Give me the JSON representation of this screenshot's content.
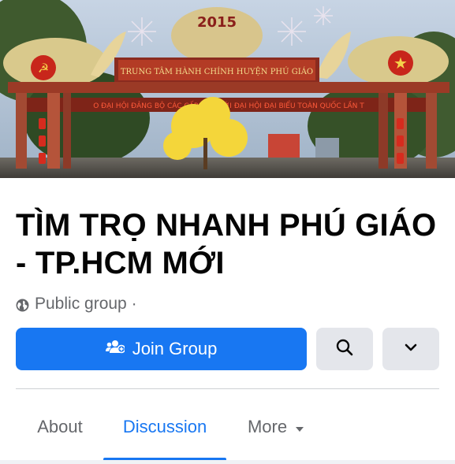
{
  "cover": {
    "year_text": "2015",
    "gate_sign": "TRUNG TÂM HÀNH CHÍNH HUYỆN PHÚ GIÁO",
    "banner_text": "O ĐẠI HỘI ĐẢNG BỘ CÁC CẤP TIẾN TỚI ĐẠI HỘI ĐẠI BIỂU TOÀN QUỐC LẦN T"
  },
  "group": {
    "name": "TÌM TRỌ NHANH PHÚ GIÁO - TP.HCM MỚI",
    "privacy": "Public group ·"
  },
  "actions": {
    "join_label": "Join Group",
    "join_icon": "join-group-icon",
    "search_icon": "search-icon",
    "more_icon": "chevron-down-icon"
  },
  "tabs": [
    {
      "label": "About",
      "active": false
    },
    {
      "label": "Discussion",
      "active": true
    },
    {
      "label": "More",
      "active": false
    }
  ],
  "colors": {
    "primary": "#1877f2",
    "secondary_button": "#e4e6eb",
    "text_dark": "#050505",
    "text_muted": "#65676b"
  }
}
